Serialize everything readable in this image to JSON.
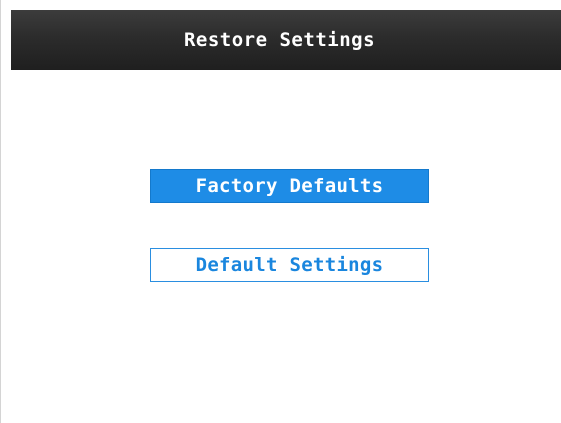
{
  "header": {
    "title": "Restore Settings"
  },
  "menu": {
    "items": [
      {
        "label": "Factory Defaults",
        "selected": true
      },
      {
        "label": "Default Settings",
        "selected": false
      }
    ]
  },
  "colors": {
    "title_bar": "#2c2c2c",
    "accent": "#1e8ce6",
    "selected_text": "#ffffff",
    "normal_text": "#1a86de",
    "background": "#ffffff"
  }
}
